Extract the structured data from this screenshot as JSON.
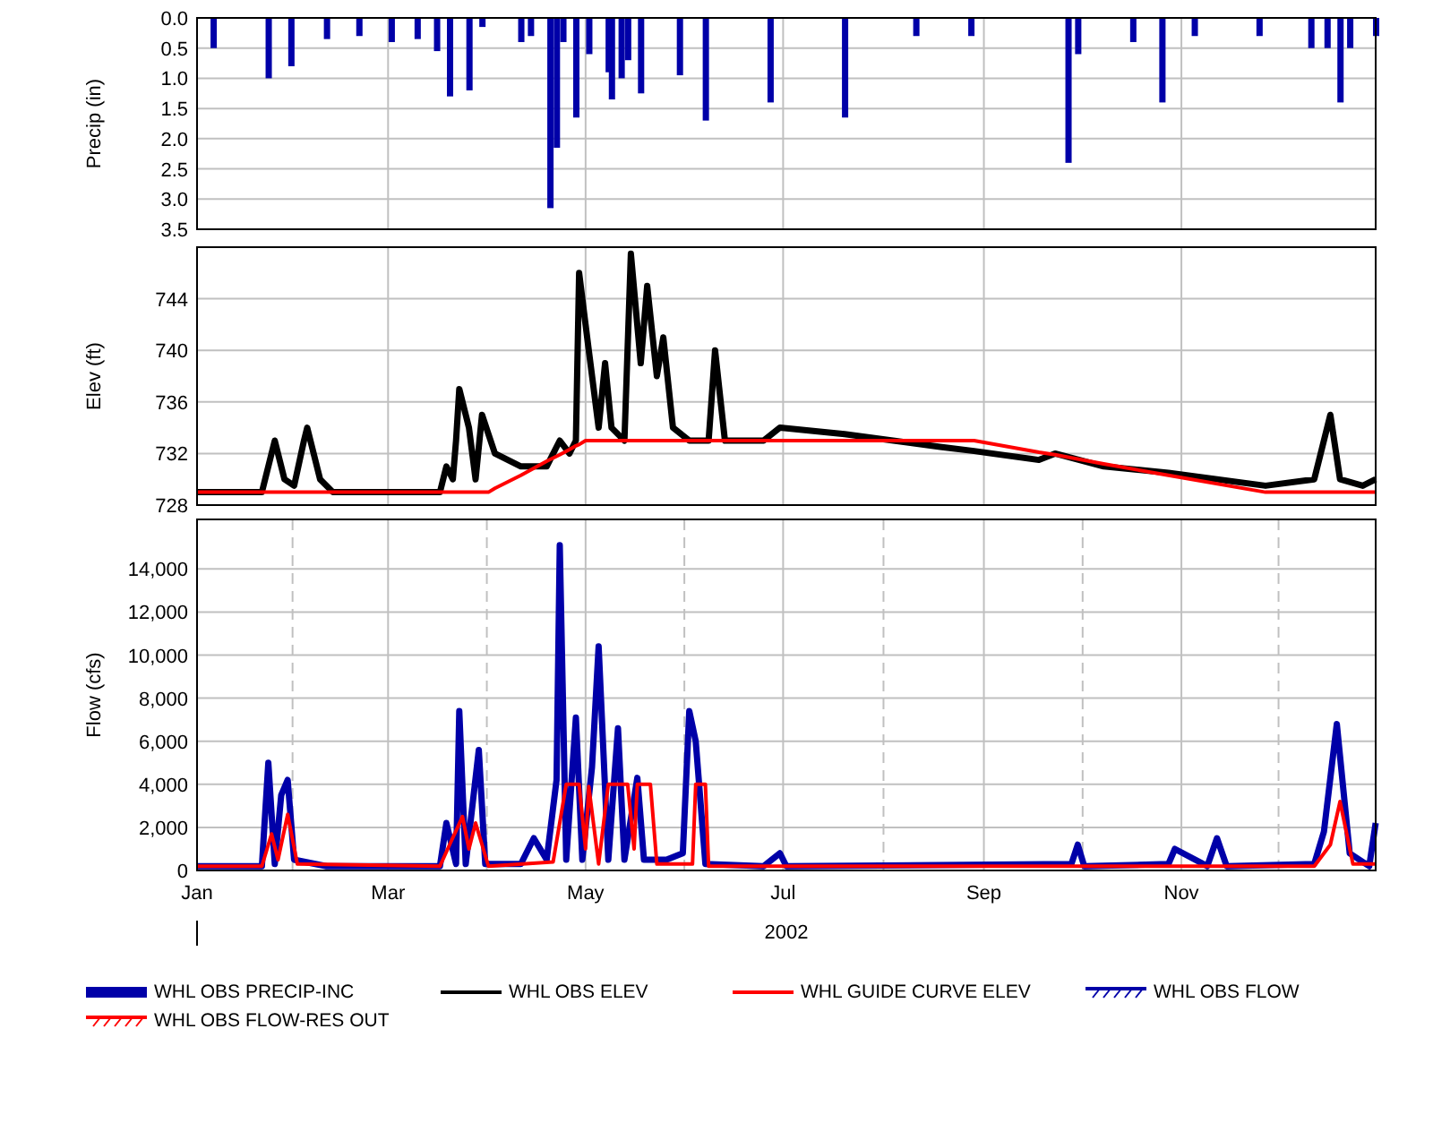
{
  "charts": [
    {
      "chart_data": {
        "type": "bar",
        "grid": true,
        "ylabel": "Precip (in)",
        "xlim": [
          "2002-01-01",
          "2002-12-31"
        ],
        "ylim": [
          3.5,
          0
        ],
        "yticks": [
          {
            "value": 0,
            "label": "0.0"
          },
          {
            "value": 0.5,
            "label": "0.5"
          },
          {
            "value": 1,
            "label": "1.0"
          },
          {
            "value": 1.5,
            "label": "1.5"
          },
          {
            "value": 2,
            "label": "2.0"
          },
          {
            "value": 2.5,
            "label": "2.5"
          },
          {
            "value": 3,
            "label": "3.0"
          },
          {
            "value": 3.5,
            "label": "3.5"
          }
        ],
        "series": [
          {
            "name": "WHL OBS PRECIP-INC",
            "color": "#0000a8",
            "x": [
              "2002-01-06",
              "2002-01-23",
              "2002-01-30",
              "2002-02-10",
              "2002-02-20",
              "2002-03-02",
              "2002-03-10",
              "2002-03-16",
              "2002-03-20",
              "2002-03-26",
              "2002-03-30",
              "2002-04-11",
              "2002-04-14",
              "2002-04-20",
              "2002-04-22",
              "2002-04-24",
              "2002-04-28",
              "2002-05-02",
              "2002-05-08",
              "2002-05-09",
              "2002-05-12",
              "2002-05-14",
              "2002-05-18",
              "2002-05-30",
              "2002-06-07",
              "2002-06-27",
              "2002-07-20",
              "2002-08-11",
              "2002-08-28",
              "2002-09-27",
              "2002-09-30",
              "2002-10-17",
              "2002-10-26",
              "2002-11-05",
              "2002-11-25",
              "2002-12-11",
              "2002-12-16",
              "2002-12-20",
              "2002-12-23",
              "2002-12-31"
            ],
            "values": [
              0.5,
              1.0,
              0.8,
              0.35,
              0.3,
              0.4,
              0.35,
              0.55,
              1.3,
              1.2,
              0.15,
              0.4,
              0.3,
              3.15,
              2.15,
              0.4,
              1.65,
              0.6,
              0.9,
              1.35,
              1.0,
              0.7,
              1.25,
              0.95,
              1.7,
              1.4,
              1.65,
              0.3,
              0.3,
              2.4,
              0.6,
              0.4,
              1.4,
              0.3,
              0.3,
              0.5,
              0.5,
              1.4,
              0.5,
              0.3
            ]
          }
        ]
      }
    },
    {
      "chart_data": {
        "type": "line",
        "grid": true,
        "ylabel": "Elev (ft)",
        "xlim": [
          "2002-01-01",
          "2002-12-31"
        ],
        "ylim": [
          728,
          748
        ],
        "yticks": [
          {
            "value": 728,
            "label": "728"
          },
          {
            "value": 732,
            "label": "732"
          },
          {
            "value": 736,
            "label": "736"
          },
          {
            "value": 740,
            "label": "740"
          },
          {
            "value": 744,
            "label": "744"
          }
        ],
        "x": [
          "2002-01-01",
          "2002-01-21",
          "2002-01-25",
          "2002-01-28",
          "2002-01-31",
          "2002-02-03",
          "2002-02-04",
          "2002-02-08",
          "2002-02-12",
          "2002-03-17",
          "2002-03-19",
          "2002-03-21",
          "2002-03-22",
          "2002-03-23",
          "2002-03-26",
          "2002-03-28",
          "2002-03-30",
          "2002-04-01",
          "2002-04-03",
          "2002-04-11",
          "2002-04-19",
          "2002-04-23",
          "2002-04-26",
          "2002-04-28",
          "2002-04-29",
          "2002-05-01",
          "2002-05-02",
          "2002-05-05",
          "2002-05-07",
          "2002-05-09",
          "2002-05-13",
          "2002-05-15",
          "2002-05-18",
          "2002-05-20",
          "2002-05-23",
          "2002-05-25",
          "2002-05-28",
          "2002-06-02",
          "2002-06-08",
          "2002-06-10",
          "2002-06-13",
          "2002-06-25",
          "2002-06-30",
          "2002-07-20",
          "2002-08-19",
          "2002-08-29",
          "2002-09-18",
          "2002-09-23",
          "2002-10-08",
          "2002-10-28",
          "2002-11-27",
          "2002-12-12",
          "2002-12-17",
          "2002-12-20",
          "2002-12-27",
          "2002-12-31"
        ],
        "series": [
          {
            "name": "WHL OBS ELEV",
            "color": "#000000",
            "values": [
              729,
              729,
              733,
              730,
              729.5,
              733,
              734,
              730,
              729,
              729,
              731,
              730,
              733,
              737,
              734,
              730,
              735,
              733.5,
              732,
              731,
              731,
              733,
              732,
              733,
              746,
              742,
              740,
              734,
              739,
              734,
              733,
              747.5,
              739,
              745,
              738,
              741,
              734,
              733,
              733,
              740,
              733,
              733,
              734,
              733.5,
              732.5,
              732.2,
              731.5,
              732,
              731,
              730.5,
              729.5,
              730,
              735,
              730,
              729.5,
              730
            ]
          },
          {
            "name": "WHL GUIDE CURVE ELEV",
            "color": "#ff0000",
            "values": [
              729,
              729,
              729,
              729,
              729,
              729,
              729,
              729,
              729,
              729,
              729,
              729,
              729,
              729,
              729,
              729,
              729,
              729,
              729.3,
              730.3,
              731.4,
              731.9,
              732.3,
              732.6,
              732.7,
              733,
              733,
              733,
              733,
              733,
              733,
              733,
              733,
              733,
              733,
              733,
              733,
              733,
              733,
              733,
              733,
              733,
              733,
              733,
              733,
              733,
              732.1,
              731.9,
              731.2,
              730.3,
              729,
              729,
              729,
              729,
              729,
              729
            ]
          }
        ]
      }
    },
    {
      "chart_data": {
        "type": "line",
        "grid": true,
        "ylabel": "Flow (cfs)",
        "xlabel": "2002",
        "xlim": [
          "2002-01-01",
          "2002-12-31"
        ],
        "ylim": [
          0,
          16300
        ],
        "yticks": [
          {
            "value": 0,
            "label": "0"
          },
          {
            "value": 2000,
            "label": "2,000"
          },
          {
            "value": 4000,
            "label": "4,000"
          },
          {
            "value": 6000,
            "label": "6,000"
          },
          {
            "value": 8000,
            "label": "8,000"
          },
          {
            "value": 10000,
            "label": "10,000"
          },
          {
            "value": 12000,
            "label": "12,000"
          },
          {
            "value": 14000,
            "label": "14,000"
          }
        ],
        "xticks": [
          {
            "value": "2002-01-01",
            "label": "Jan"
          },
          {
            "value": "2002-03-01",
            "label": "Mar"
          },
          {
            "value": "2002-05-01",
            "label": "May"
          },
          {
            "value": "2002-07-01",
            "label": "Jul"
          },
          {
            "value": "2002-09-01",
            "label": "Sep"
          },
          {
            "value": "2002-11-01",
            "label": "Nov"
          }
        ],
        "series": [
          {
            "name": "WHL OBS FLOW",
            "color": "#0000a8",
            "x": [
              "2002-01-01",
              "2002-01-21",
              "2002-01-23",
              "2002-01-25",
              "2002-01-27",
              "2002-01-29",
              "2002-01-31",
              "2002-02-10",
              "2002-03-17",
              "2002-03-19",
              "2002-03-22",
              "2002-03-23",
              "2002-03-25",
              "2002-03-29",
              "2002-03-31",
              "2002-04-11",
              "2002-04-15",
              "2002-04-19",
              "2002-04-22",
              "2002-04-23",
              "2002-04-25",
              "2002-04-28",
              "2002-04-30",
              "2002-05-03",
              "2002-05-05",
              "2002-05-08",
              "2002-05-11",
              "2002-05-13",
              "2002-05-17",
              "2002-05-19",
              "2002-05-26",
              "2002-05-31",
              "2002-06-02",
              "2002-06-04",
              "2002-06-07",
              "2002-06-25",
              "2002-06-30",
              "2002-07-02",
              "2002-09-28",
              "2002-09-30",
              "2002-10-02",
              "2002-10-28",
              "2002-10-30",
              "2002-11-09",
              "2002-11-12",
              "2002-11-15",
              "2002-12-12",
              "2002-12-15",
              "2002-12-19",
              "2002-12-23",
              "2002-12-29",
              "2002-12-31"
            ],
            "values": [
              200,
              200,
              5000,
              300,
              3500,
              4200,
              500,
              200,
              200,
              2200,
              300,
              7400,
              300,
              5600,
              300,
              300,
              1500,
              500,
              4200,
              15100,
              500,
              7100,
              500,
              4800,
              10400,
              500,
              6600,
              500,
              4300,
              500,
              500,
              800,
              7400,
              6000,
              300,
              200,
              800,
              200,
              300,
              1200,
              200,
              300,
              1000,
              200,
              1500,
              200,
              300,
              1800,
              6800,
              800,
              200,
              2200
            ]
          },
          {
            "name": "WHL OBS FLOW-RES OUT",
            "color": "#ff0000",
            "x": [
              "2002-01-01",
              "2002-01-21",
              "2002-01-24",
              "2002-01-26",
              "2002-01-29",
              "2002-02-01",
              "2002-03-17",
              "2002-03-20",
              "2002-03-24",
              "2002-03-26",
              "2002-03-28",
              "2002-04-01",
              "2002-04-21",
              "2002-04-25",
              "2002-04-29",
              "2002-05-01",
              "2002-05-02",
              "2002-05-05",
              "2002-05-08",
              "2002-05-14",
              "2002-05-16",
              "2002-05-17",
              "2002-05-21",
              "2002-05-23",
              "2002-06-03",
              "2002-06-04",
              "2002-06-07",
              "2002-06-08",
              "2002-12-12",
              "2002-12-17",
              "2002-12-20",
              "2002-12-24",
              "2002-12-31"
            ],
            "values": [
              200,
              200,
              1700,
              500,
              2600,
              300,
              200,
              1200,
              2500,
              1000,
              2200,
              200,
              400,
              4000,
              4000,
              1000,
              3900,
              300,
              4000,
              4000,
              1000,
              4000,
              4000,
              300,
              300,
              4000,
              4000,
              200,
              200,
              1200,
              3200,
              300,
              300
            ]
          }
        ]
      }
    }
  ],
  "legend": [
    {
      "kind": "thick"
    },
    {
      "kind": "line"
    },
    {
      "kind": "line"
    },
    {
      "kind": "hatched"
    },
    {
      "kind": "hatched"
    }
  ]
}
